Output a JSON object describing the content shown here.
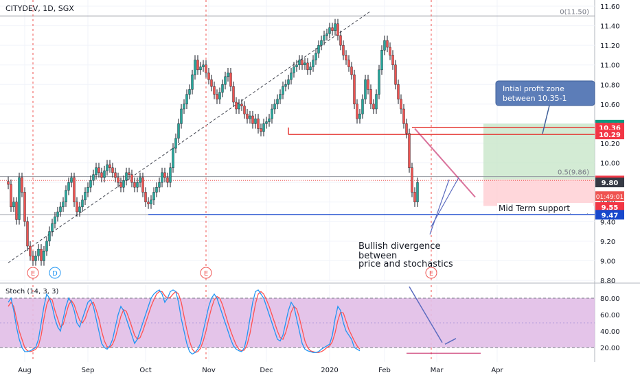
{
  "symbol_label": "CITYDEV, 1D, SGX",
  "stoch_label": "Stoch (14, 3, 3)",
  "countdown": "01:49:01",
  "chart_data": {
    "type": "candlestick",
    "price_axis": {
      "ticks": [
        8.8,
        9.0,
        9.2,
        9.4,
        9.6,
        9.8,
        10.0,
        10.2,
        10.4,
        10.6,
        10.8,
        11.0,
        11.2,
        11.4,
        11.6
      ],
      "ylim": [
        8.8,
        11.6
      ]
    },
    "stoch_axis": {
      "ticks": [
        20.0,
        40.0,
        60.0,
        80.0
      ],
      "ylim": [
        0,
        100
      ],
      "band": [
        20,
        80
      ]
    },
    "x_ticks": [
      {
        "label": "Aug",
        "bar": 6
      },
      {
        "label": "Sep",
        "bar": 29
      },
      {
        "label": "Oct",
        "bar": 50
      },
      {
        "label": "Nov",
        "bar": 73
      },
      {
        "label": "Dec",
        "bar": 94
      },
      {
        "label": "2020",
        "bar": 117
      },
      {
        "label": "Feb",
        "bar": 137
      },
      {
        "label": "Mar",
        "bar": 156
      },
      {
        "label": "Apr",
        "bar": 178
      }
    ],
    "closes": [
      9.78,
      9.55,
      9.6,
      9.42,
      9.85,
      9.7,
      9.4,
      9.15,
      9.05,
      9.0,
      9.05,
      9.12,
      9.0,
      9.1,
      9.2,
      9.3,
      9.38,
      9.45,
      9.5,
      9.55,
      9.6,
      9.72,
      9.8,
      9.85,
      9.6,
      9.5,
      9.55,
      9.62,
      9.7,
      9.75,
      9.82,
      9.88,
      9.95,
      9.9,
      9.85,
      9.92,
      9.98,
      9.95,
      9.9,
      9.85,
      9.8,
      9.75,
      9.82,
      9.9,
      9.88,
      9.8,
      9.75,
      9.8,
      9.85,
      9.7,
      9.6,
      9.58,
      9.62,
      9.7,
      9.75,
      9.8,
      9.9,
      9.85,
      9.8,
      9.95,
      10.15,
      10.25,
      10.4,
      10.55,
      10.6,
      10.7,
      10.75,
      10.9,
      11.05,
      10.95,
      10.98,
      11.0,
      10.92,
      10.85,
      10.78,
      10.7,
      10.65,
      10.72,
      10.8,
      10.88,
      10.92,
      10.78,
      10.62,
      10.55,
      10.6,
      10.58,
      10.5,
      10.45,
      10.48,
      10.4,
      10.45,
      10.35,
      10.32,
      10.4,
      10.42,
      10.45,
      10.55,
      10.6,
      10.65,
      10.7,
      10.78,
      10.8,
      10.85,
      10.92,
      10.98,
      11.0,
      11.05,
      11.0,
      11.02,
      10.95,
      10.98,
      11.05,
      11.12,
      11.2,
      11.25,
      11.3,
      11.32,
      11.38,
      11.35,
      11.42,
      11.3,
      11.2,
      11.1,
      11.05,
      10.98,
      10.9,
      10.6,
      10.45,
      10.5,
      10.65,
      10.85,
      10.75,
      10.6,
      10.55,
      10.7,
      10.95,
      11.15,
      11.25,
      11.18,
      11.1,
      11.0,
      10.8,
      10.65,
      10.55,
      10.4,
      10.3,
      9.95,
      9.7,
      9.6,
      9.8
    ],
    "stochastics": {
      "k": [
        75,
        80,
        65,
        45,
        30,
        20,
        15,
        15,
        16,
        18,
        20,
        30,
        50,
        70,
        85,
        80,
        70,
        55,
        45,
        40,
        55,
        70,
        80,
        75,
        65,
        50,
        45,
        55,
        65,
        75,
        78,
        70,
        55,
        40,
        25,
        20,
        18,
        22,
        30,
        45,
        60,
        70,
        65,
        55,
        45,
        35,
        25,
        30,
        40,
        50,
        60,
        70,
        80,
        85,
        88,
        90,
        85,
        75,
        80,
        88,
        90,
        88,
        75,
        55,
        40,
        25,
        15,
        12,
        14,
        18,
        25,
        40,
        55,
        70,
        80,
        85,
        80,
        70,
        60,
        50,
        40,
        30,
        22,
        18,
        16,
        15,
        20,
        35,
        55,
        75,
        88,
        90,
        85,
        80,
        70,
        60,
        50,
        40,
        30,
        28,
        35,
        50,
        65,
        75,
        70,
        55,
        40,
        25,
        18,
        16,
        15,
        14,
        14,
        15,
        18,
        20,
        22,
        24,
        35,
        55,
        70,
        65,
        50,
        40,
        35,
        30,
        20,
        18,
        16
      ],
      "d": [
        70,
        75,
        70,
        55,
        40,
        30,
        20,
        16,
        15,
        16,
        18,
        22,
        35,
        55,
        72,
        80,
        78,
        65,
        55,
        45,
        48,
        60,
        72,
        77,
        72,
        62,
        53,
        50,
        55,
        65,
        73,
        75,
        66,
        55,
        40,
        28,
        21,
        20,
        24,
        32,
        45,
        58,
        66,
        64,
        55,
        45,
        35,
        30,
        32,
        40,
        50,
        60,
        70,
        78,
        85,
        88,
        88,
        83,
        80,
        81,
        85,
        88,
        85,
        75,
        58,
        42,
        28,
        18,
        14,
        15,
        19,
        28,
        40,
        55,
        68,
        78,
        82,
        80,
        72,
        61,
        50,
        40,
        31,
        23,
        18,
        16,
        17,
        24,
        37,
        55,
        73,
        85,
        88,
        85,
        78,
        70,
        60,
        50,
        40,
        32,
        30,
        38,
        50,
        63,
        70,
        67,
        56,
        42,
        28,
        20,
        16,
        15,
        14,
        14,
        15,
        17,
        20,
        22,
        27,
        38,
        53,
        63,
        62,
        52,
        42,
        35,
        28,
        22,
        18
      ]
    },
    "levels": [
      {
        "label": "0(11.50)",
        "value": 11.5
      },
      {
        "label": "0.5(9.86)",
        "value": 9.86
      },
      {
        "label": "0.618(9.47)",
        "value": 9.47
      }
    ],
    "price_tags": [
      {
        "label": "10.39",
        "value": 10.39,
        "color": "#089981"
      },
      {
        "label": "10.36",
        "value": 10.36,
        "color": "#f23645"
      },
      {
        "label": "10.29",
        "value": 10.29,
        "color": "#f23645"
      },
      {
        "label": "9.82",
        "value": 9.82,
        "color": "#f23645"
      },
      {
        "label": "9.80",
        "value": 9.8,
        "color": "#363a45"
      },
      {
        "label": "9.55",
        "value": 9.55,
        "color": "#f23645"
      },
      {
        "label": "9.47",
        "value": 9.47,
        "color": "#1848cc"
      }
    ],
    "annotations": {
      "profit_zone_callout": "Intial profit zone between 10.35-1",
      "divergence_text": "Bullish divergence between price and stochastics",
      "support_text": "Mid Term support"
    },
    "events": [
      {
        "label": "E",
        "bar": 9
      },
      {
        "label": "D",
        "bar": 17
      },
      {
        "label": "E",
        "bar": 72
      },
      {
        "label": "E",
        "bar": 154
      }
    ],
    "colors": {
      "up": "#26a69a",
      "down": "#ef5350",
      "stoch_k": "#2196f3",
      "stoch_d": "#ff5252",
      "stoch_band": "#e1bee7",
      "profit": "#c8e6c9",
      "loss": "#ffcdd2",
      "support": "#1848cc",
      "resistance": "#e53935"
    }
  }
}
